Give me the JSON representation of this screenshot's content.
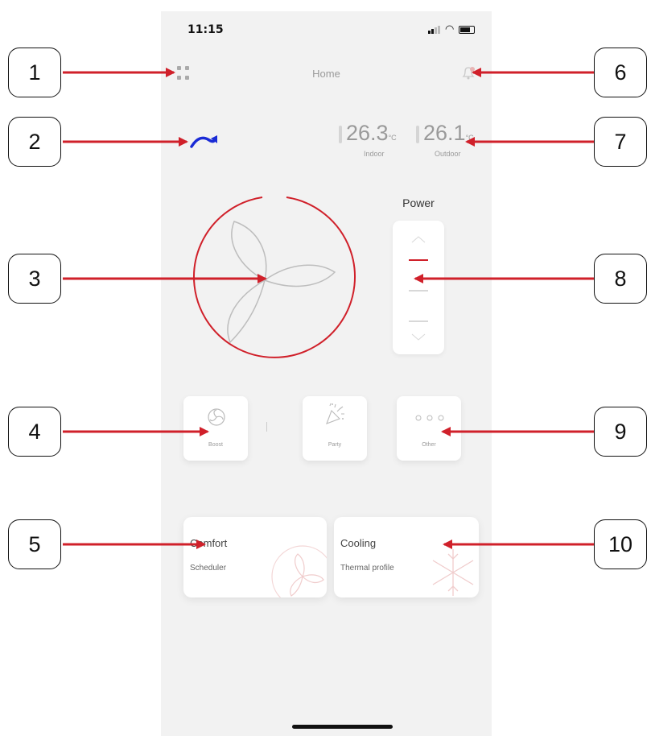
{
  "status_bar": {
    "time": "11:15"
  },
  "header": {
    "title": "Home"
  },
  "temperatures": {
    "indoor": {
      "value": "26.3",
      "unit": "°C",
      "label": "Indoor"
    },
    "outdoor": {
      "value": "26.1",
      "unit": "°C",
      "label": "Outdoor"
    }
  },
  "power": {
    "label": "Power",
    "levels": 3,
    "current_level": 3
  },
  "modes": [
    {
      "label": "Boost",
      "icon": "fan-boost-icon"
    },
    {
      "label": "Party",
      "icon": "confetti-icon"
    },
    {
      "label": "Other",
      "icon": "more-dots-icon"
    }
  ],
  "cards": [
    {
      "title": "Comfort",
      "subtitle": "Scheduler",
      "icon": "fan-icon"
    },
    {
      "title": "Cooling",
      "subtitle": "Thermal profile",
      "icon": "snowflake-icon"
    }
  ],
  "callouts": [
    "1",
    "2",
    "3",
    "4",
    "5",
    "6",
    "7",
    "8",
    "9",
    "10"
  ],
  "colors": {
    "accent": "#d0202a",
    "mode_blue": "#1a2bd6",
    "background": "#f2f2f2"
  }
}
